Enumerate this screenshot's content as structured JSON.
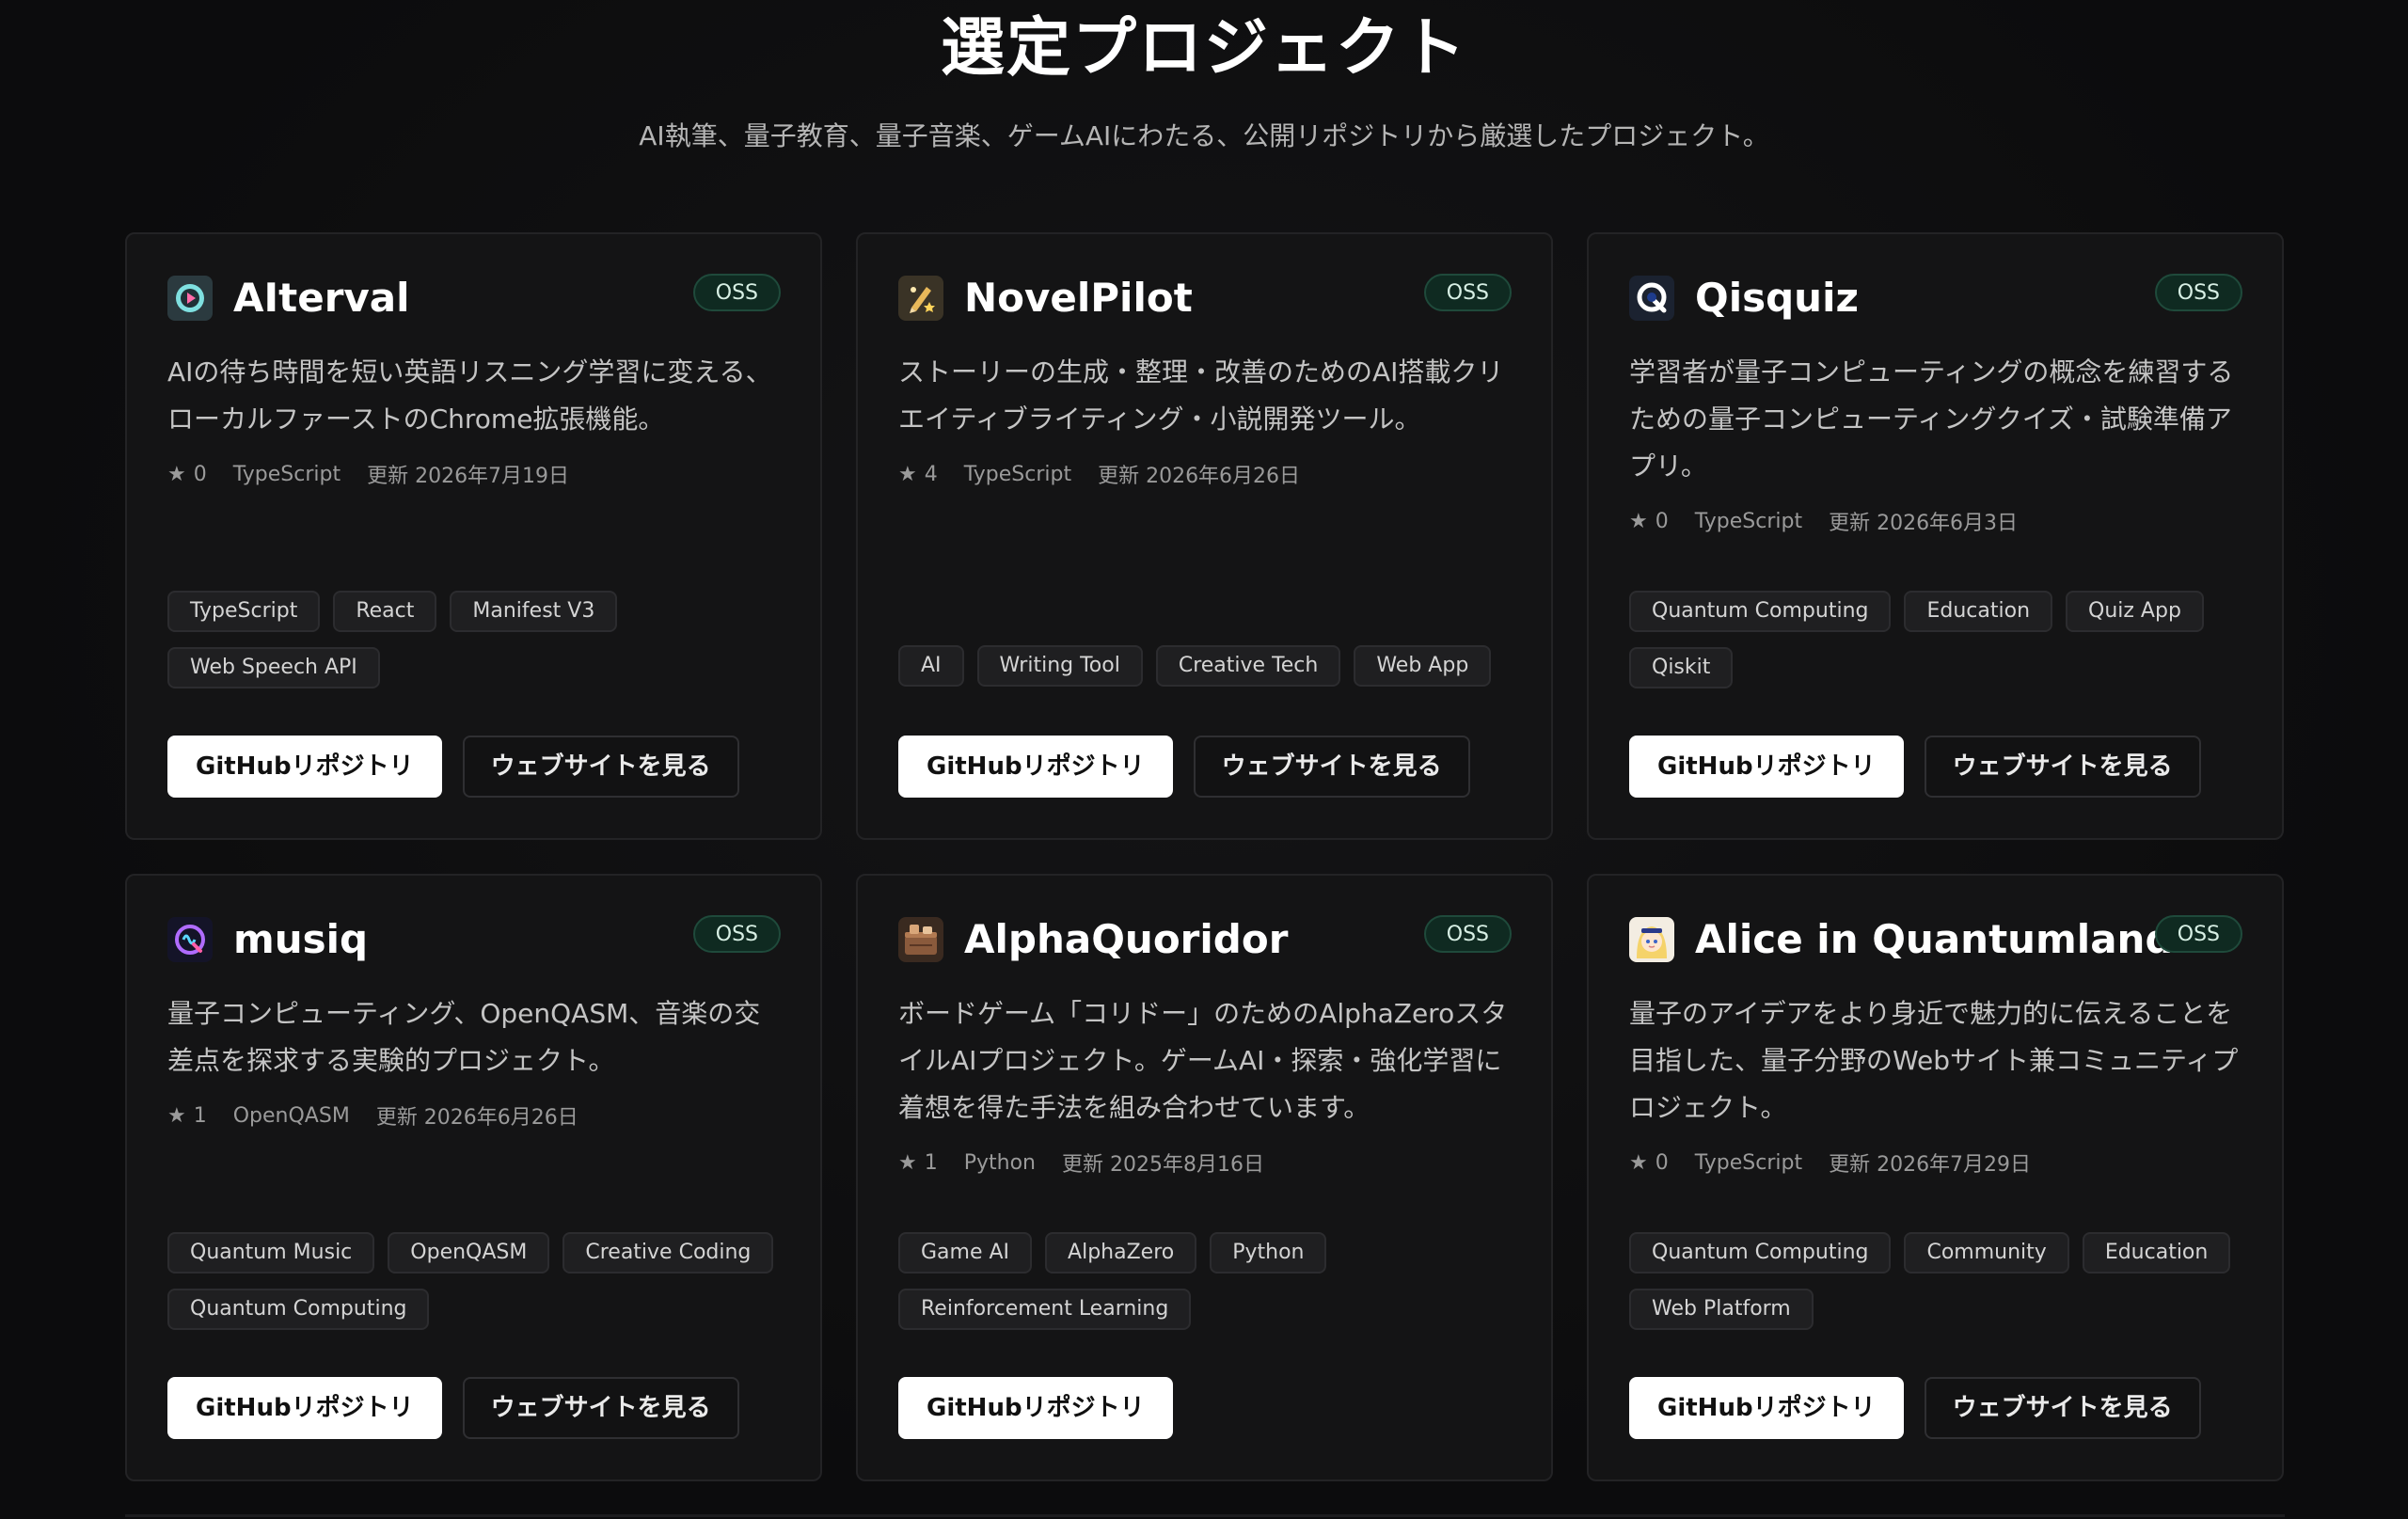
{
  "section": {
    "title": "選定プロジェクト",
    "subtitle": "AI執筆、量子教育、量子音楽、ゲームAIにわたる、公開リポジトリから厳選したプロジェクト。"
  },
  "colors": {
    "background": "#0c0c0d",
    "card": "#141415",
    "badge_bg": "#0f2a21",
    "primary_button": "#ffffff"
  },
  "projects": [
    {
      "name": "AIterval",
      "icon": "play-bubble-icon",
      "badge": "OSS",
      "description": "AIの待ち時間を短い英語リスニング学習に変える、ローカルファーストのChrome拡張機能。",
      "stars": "0",
      "language": "TypeScript",
      "updated": "更新 2026年7月19日",
      "tags": [
        "TypeScript",
        "React",
        "Manifest V3",
        "Web Speech API"
      ],
      "github_label": "GitHubリポジトリ",
      "website_label": "ウェブサイトを見る"
    },
    {
      "name": "NovelPilot",
      "icon": "pen-star-icon",
      "badge": "OSS",
      "description": "ストーリーの生成・整理・改善のためのAI搭載クリエイティブライティング・小説開発ツール。",
      "stars": "4",
      "language": "TypeScript",
      "updated": "更新 2026年6月26日",
      "tags": [
        "AI",
        "Writing Tool",
        "Creative Tech",
        "Web App"
      ],
      "github_label": "GitHubリポジトリ",
      "website_label": "ウェブサイトを見る"
    },
    {
      "name": "Qisquiz",
      "icon": "q-logo-icon",
      "badge": "OSS",
      "description": "学習者が量子コンピューティングの概念を練習するための量子コンピューティングクイズ・試験準備アプリ。",
      "stars": "0",
      "language": "TypeScript",
      "updated": "更新 2026年6月3日",
      "tags": [
        "Quantum Computing",
        "Education",
        "Quiz App",
        "Qiskit"
      ],
      "github_label": "GitHubリポジトリ",
      "website_label": "ウェブサイトを見る"
    },
    {
      "name": "musiq",
      "icon": "q-wave-icon",
      "badge": "OSS",
      "description": "量子コンピューティング、OpenQASM、音楽の交差点を探求する実験的プロジェクト。",
      "stars": "1",
      "language": "OpenQASM",
      "updated": "更新 2026年6月26日",
      "tags": [
        "Quantum Music",
        "OpenQASM",
        "Creative Coding",
        "Quantum Computing"
      ],
      "github_label": "GitHubリポジトリ",
      "website_label": "ウェブサイトを見る"
    },
    {
      "name": "AlphaQuoridor",
      "icon": "board-game-icon",
      "badge": "OSS",
      "description": "ボードゲーム「コリドー」のためのAlphaZeroスタイルAIプロジェクト。ゲームAI・探索・強化学習に着想を得た手法を組み合わせています。",
      "stars": "1",
      "language": "Python",
      "updated": "更新 2025年8月16日",
      "tags": [
        "Game AI",
        "AlphaZero",
        "Python",
        "Reinforcement Learning"
      ],
      "github_label": "GitHubリポジトリ",
      "website_label": ""
    },
    {
      "name": "Alice in Quantumland",
      "icon": "alice-avatar-icon",
      "badge": "OSS",
      "description": "量子のアイデアをより身近で魅力的に伝えることを目指した、量子分野のWebサイト兼コミュニティプロジェクト。",
      "stars": "0",
      "language": "TypeScript",
      "updated": "更新 2026年7月29日",
      "tags": [
        "Quantum Computing",
        "Community",
        "Education",
        "Web Platform"
      ],
      "github_label": "GitHubリポジトリ",
      "website_label": "ウェブサイトを見る"
    }
  ]
}
